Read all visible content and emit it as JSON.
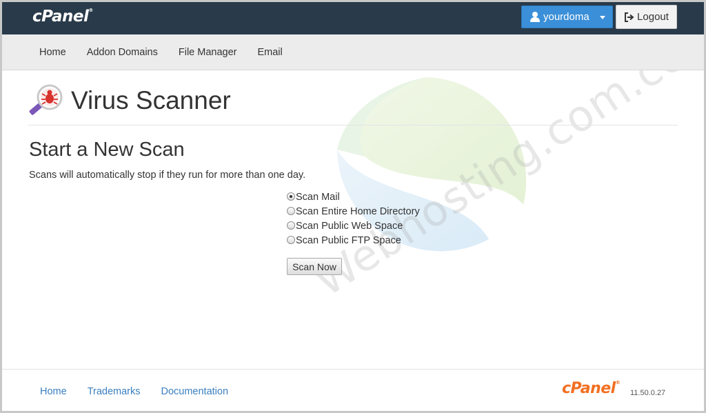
{
  "header": {
    "brand": "cPanel",
    "user_label": "yourdoma",
    "logout_label": "Logout"
  },
  "nav": {
    "items": [
      {
        "label": "Home"
      },
      {
        "label": "Addon Domains"
      },
      {
        "label": "File Manager"
      },
      {
        "label": "Email"
      }
    ]
  },
  "page": {
    "title": "Virus Scanner",
    "section_title": "Start a New Scan",
    "section_desc": "Scans will automatically stop if they run for more than one day.",
    "options": [
      {
        "label": "Scan Mail",
        "checked": true
      },
      {
        "label": "Scan Entire Home Directory",
        "checked": false
      },
      {
        "label": "Scan Public Web Space",
        "checked": false
      },
      {
        "label": "Scan Public FTP Space",
        "checked": false
      }
    ],
    "scan_button": "Scan Now"
  },
  "watermark": {
    "text": "Webhosting.com.co.th"
  },
  "footer": {
    "links": [
      {
        "label": "Home"
      },
      {
        "label": "Trademarks"
      },
      {
        "label": "Documentation"
      }
    ],
    "brand": "cPanel",
    "version": "11.50.0.27"
  },
  "colors": {
    "topbar": "#293a4a",
    "accent": "#3a8fd8",
    "link": "#3a7fc0",
    "brand_orange": "#f26f21"
  }
}
